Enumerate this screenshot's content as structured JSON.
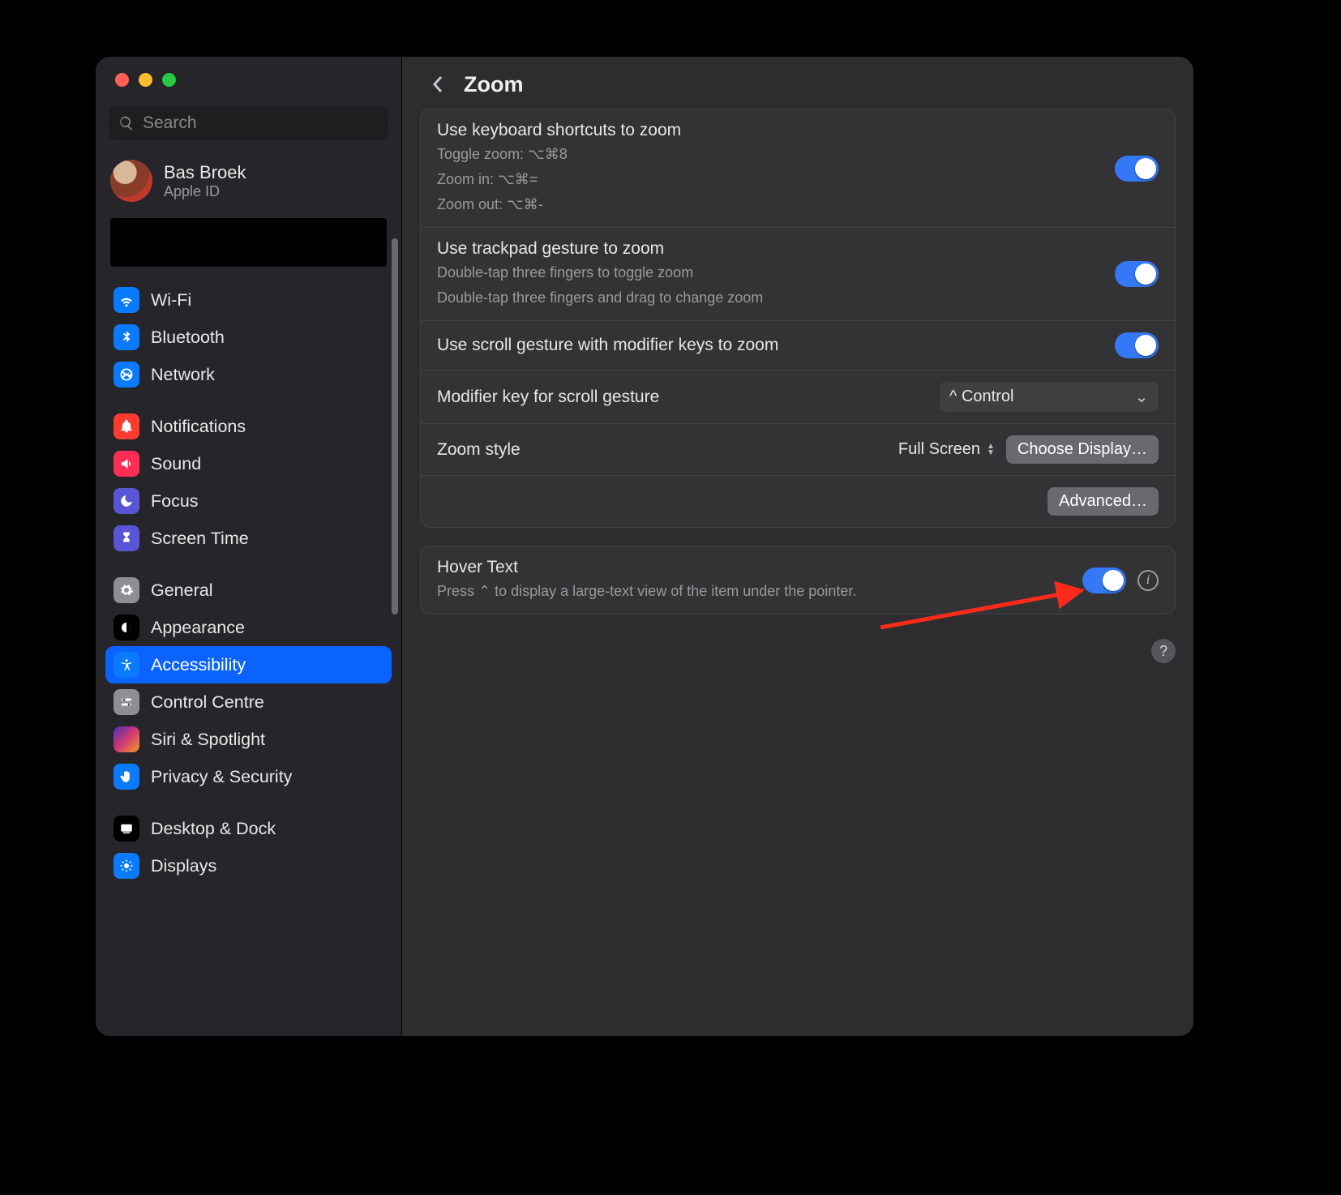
{
  "search": {
    "placeholder": "Search"
  },
  "account": {
    "name": "Bas Broek",
    "sub": "Apple ID"
  },
  "sidebar": {
    "items": [
      {
        "label": "Wi-Fi"
      },
      {
        "label": "Bluetooth"
      },
      {
        "label": "Network"
      },
      {
        "label": "Notifications"
      },
      {
        "label": "Sound"
      },
      {
        "label": "Focus"
      },
      {
        "label": "Screen Time"
      },
      {
        "label": "General"
      },
      {
        "label": "Appearance"
      },
      {
        "label": "Accessibility"
      },
      {
        "label": "Control Centre"
      },
      {
        "label": "Siri & Spotlight"
      },
      {
        "label": "Privacy & Security"
      },
      {
        "label": "Desktop & Dock"
      },
      {
        "label": "Displays"
      }
    ]
  },
  "header": {
    "title": "Zoom"
  },
  "panel1": {
    "kb": {
      "title": "Use keyboard shortcuts to zoom",
      "l1": "Toggle zoom: ⌥⌘8",
      "l2": "Zoom in: ⌥⌘=",
      "l3": "Zoom out: ⌥⌘-"
    },
    "trackpad": {
      "title": "Use trackpad gesture to zoom",
      "l1": "Double-tap three fingers to toggle zoom",
      "l2": "Double-tap three fingers and drag to change zoom"
    },
    "scroll": {
      "title": "Use scroll gesture with modifier keys to zoom"
    },
    "modkey": {
      "label": "Modifier key for scroll gesture",
      "value": "^ Control"
    },
    "zoomstyle": {
      "label": "Zoom style",
      "value": "Full Screen",
      "choose": "Choose Display…"
    },
    "advanced": "Advanced…"
  },
  "panel2": {
    "title": "Hover Text",
    "desc": "Press ⌃ to display a large-text view of the item under the pointer."
  },
  "help": "?"
}
